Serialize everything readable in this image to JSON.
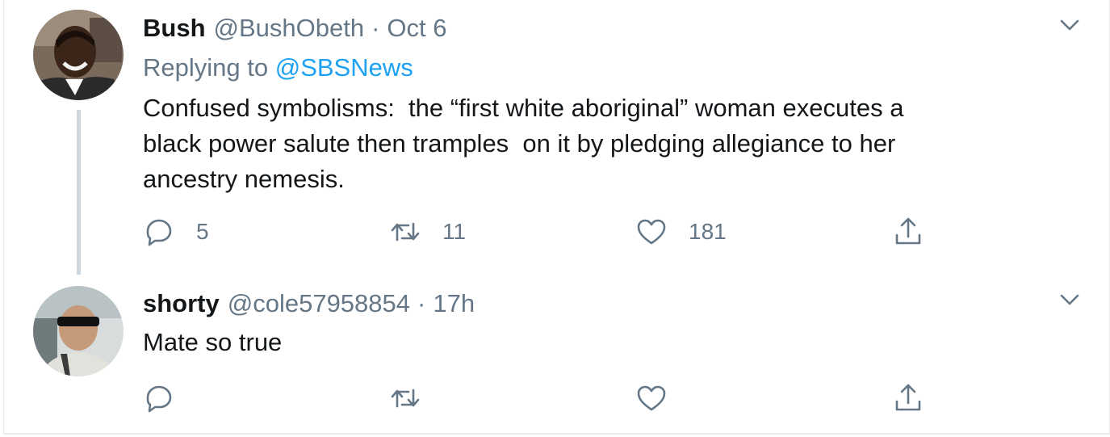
{
  "tweets": [
    {
      "display_name": "Bush",
      "handle": "@BushObeth",
      "separator": "·",
      "time": "Oct 6",
      "replying_prefix": "Replying to",
      "replying_to": "@SBSNews",
      "text": "Confused symbolisms:  the “first white aboriginal” woman executes a\nblack power salute then tramples  on it by pledging allegiance to her\nancestry nemesis.",
      "replies": "5",
      "retweets": "11",
      "likes": "181"
    },
    {
      "display_name": "shorty",
      "handle": "@cole57958854",
      "separator": "·",
      "time": "17h",
      "text": "Mate so true"
    }
  ],
  "colors": {
    "primary_text": "#14171a",
    "secondary_text": "#657786",
    "link": "#1da1f2",
    "thread_line": "#ccd6dd",
    "border": "#e6ecf0"
  },
  "icons": {
    "reply": "reply-icon",
    "retweet": "retweet-icon",
    "like": "heart-icon",
    "share": "share-icon",
    "more": "chevron-down-icon"
  }
}
